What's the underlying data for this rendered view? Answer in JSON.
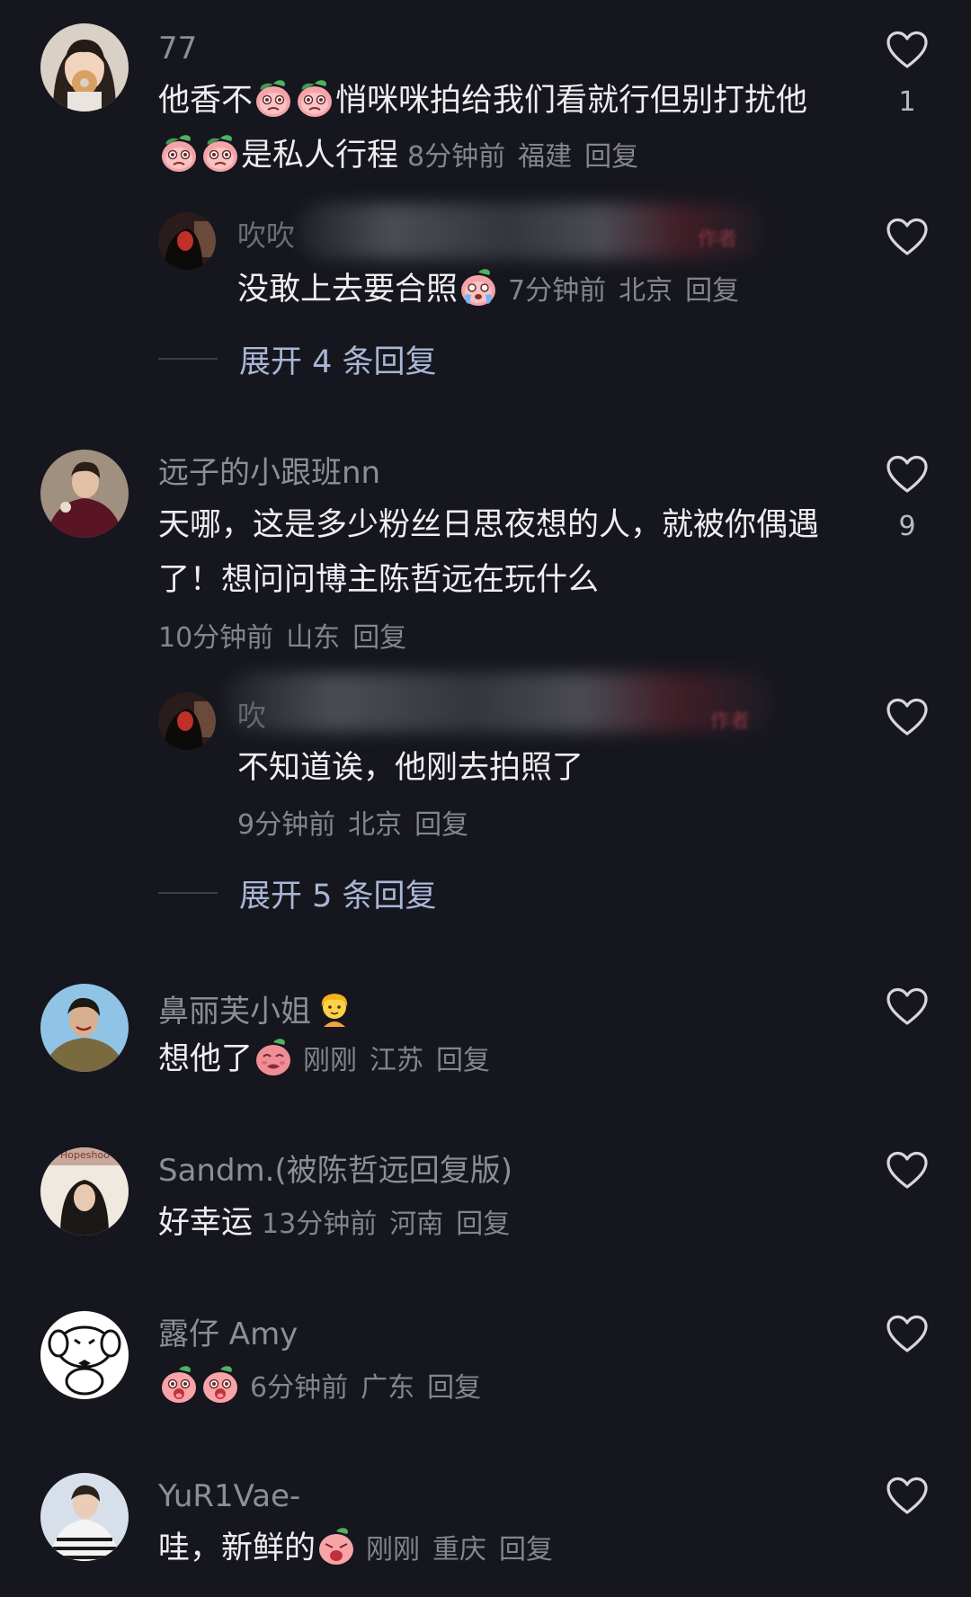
{
  "comments": [
    {
      "username": "77",
      "text_parts": [
        "他香不",
        "悄咪咪拍给我们看就行但别打扰他",
        "是私人行程"
      ],
      "time": "8分钟前",
      "location": "福建",
      "reply_label": "回复",
      "likes": "1",
      "avatar_icon": "girl-with-donut-avatar",
      "reply": {
        "username_partial": "吹吹",
        "author_tag": "作者",
        "text": "没敢上去要合照",
        "time": "7分钟前",
        "location": "北京",
        "reply_label": "回复"
      },
      "expand_label": "展开 4 条回复"
    },
    {
      "username": "远子的小跟班nn",
      "text": "天哪，这是多少粉丝日思夜想的人，就被你偶遇了！想问问博主陈哲远在玩什么",
      "time": "10分钟前",
      "location": "山东",
      "reply_label": "回复",
      "likes": "9",
      "reply": {
        "username_partial": "吹",
        "author_tag": "作者",
        "text": "不知道诶，他刚去拍照了",
        "time": "9分钟前",
        "location": "北京",
        "reply_label": "回复"
      },
      "expand_label": "展开 5 条回复"
    },
    {
      "username": "鼻丽芙小姐",
      "text": "想他了",
      "time": "刚刚",
      "location": "江苏",
      "reply_label": "回复"
    },
    {
      "username": "Sandm.(被陈哲远回复版)",
      "text": "好幸运",
      "time": "13分钟前",
      "location": "河南",
      "reply_label": "回复",
      "avatar_text": "Hopeshoo"
    },
    {
      "username": "露仔 Amy",
      "text": "",
      "time": "6分钟前",
      "location": "广东",
      "reply_label": "回复"
    },
    {
      "username": "YuR1Vae-",
      "text": "哇，新鲜的",
      "time": "刚刚",
      "location": "重庆",
      "reply_label": "回复"
    }
  ],
  "colors": {
    "background": "#16161e",
    "username": "#8d8e96",
    "text": "#eeeef1",
    "meta": "#84858d",
    "expand": "#a9b6d6"
  }
}
